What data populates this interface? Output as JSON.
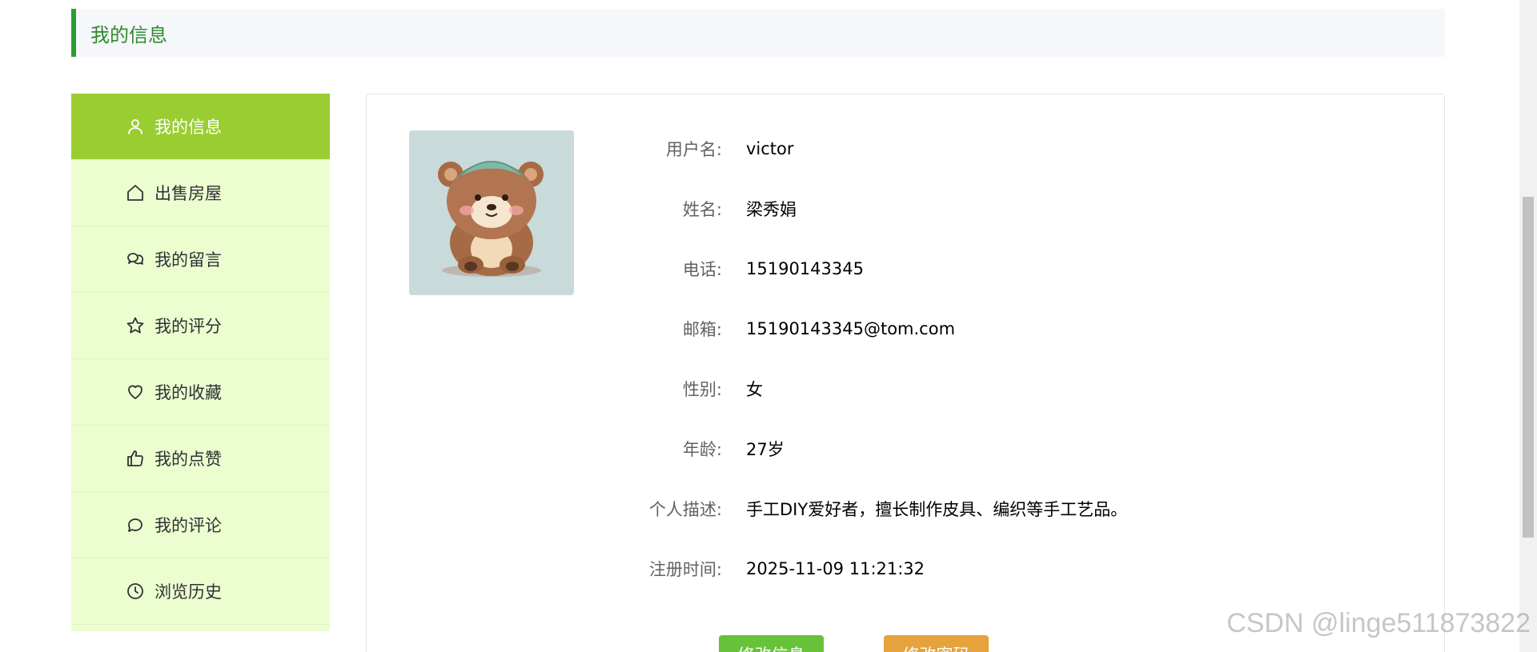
{
  "header": {
    "title": "我的信息"
  },
  "sidebar": {
    "items": [
      {
        "label": "我的信息",
        "icon": "user-icon",
        "active": true
      },
      {
        "label": "出售房屋",
        "icon": "house-icon"
      },
      {
        "label": "我的留言",
        "icon": "chat-icon"
      },
      {
        "label": "我的评分",
        "icon": "star-icon"
      },
      {
        "label": "我的收藏",
        "icon": "heart-icon"
      },
      {
        "label": "我的点赞",
        "icon": "thumbs-up-icon"
      },
      {
        "label": "我的评论",
        "icon": "comment-icon"
      },
      {
        "label": "浏览历史",
        "icon": "clock-icon"
      }
    ]
  },
  "profile": {
    "fields": [
      {
        "label": "用户名:",
        "value": "victor"
      },
      {
        "label": "姓名:",
        "value": "梁秀娟"
      },
      {
        "label": "电话:",
        "value": "15190143345"
      },
      {
        "label": "邮箱:",
        "value": "15190143345@tom.com"
      },
      {
        "label": "性别:",
        "value": "女"
      },
      {
        "label": "年龄:",
        "value": "27岁"
      },
      {
        "label": "个人描述:",
        "value": "手工DIY爱好者，擅长制作皮具、编织等手工艺品。"
      },
      {
        "label": "注册时间:",
        "value": "2025-11-09 11:21:32"
      }
    ]
  },
  "actions": {
    "edit_info": "修改信息",
    "edit_password": "修改密码"
  },
  "watermark": "CSDN @linge511873822",
  "colors": {
    "accent": "#9acd32",
    "sidebar_bg": "#ecfdd0",
    "title_green": "#2e8b2e",
    "btn_info": "#67c23a",
    "btn_password": "#e6a23c"
  }
}
